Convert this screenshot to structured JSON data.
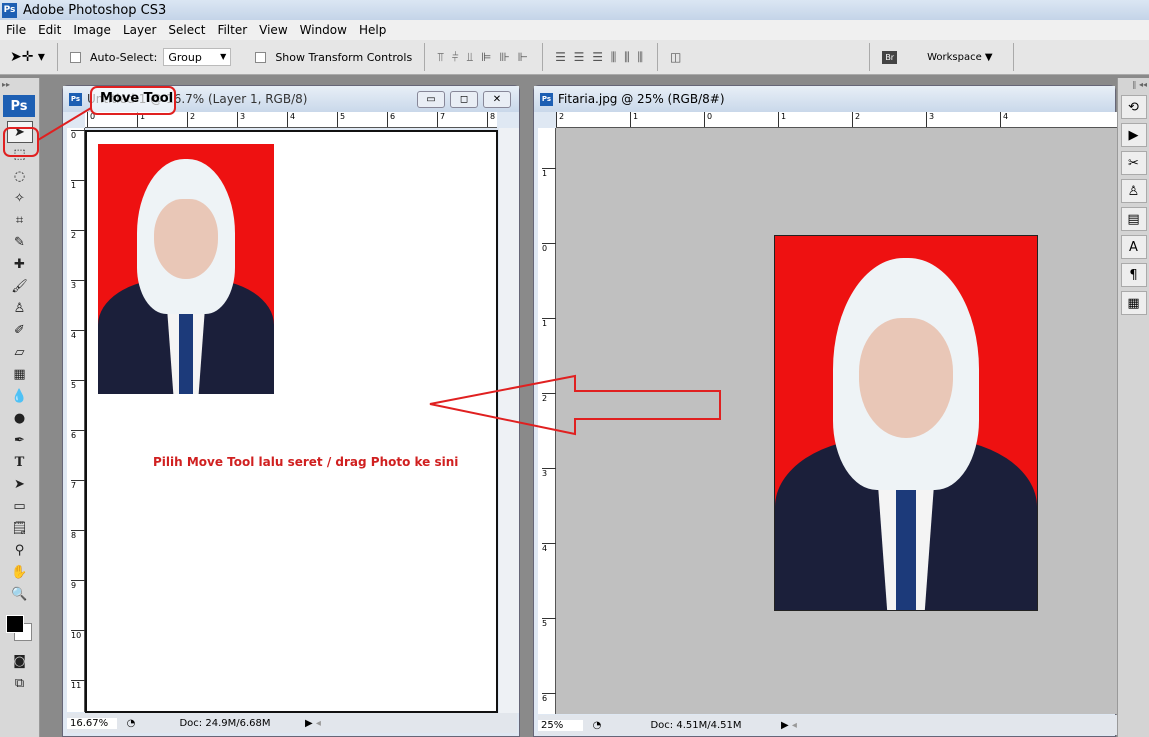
{
  "app": {
    "title": "Adobe Photoshop CS3",
    "logo": "Ps"
  },
  "menu": [
    "File",
    "Edit",
    "Image",
    "Layer",
    "Select",
    "Filter",
    "View",
    "Window",
    "Help"
  ],
  "options": {
    "auto_select_label": "Auto-Select:",
    "auto_select_value": "Group",
    "show_transform_label": "Show Transform Controls",
    "workspace_label": "Workspace ▼",
    "bridge_icon": "Br"
  },
  "doc1": {
    "title": "Untitled-1 @ 16.7% (Layer 1, RGB/8)",
    "zoom": "16.67%",
    "doc_info": "Doc: 24.9M/6.68M",
    "ruler_h": [
      "0",
      "1",
      "2",
      "3",
      "4",
      "5",
      "6",
      "7",
      "8"
    ],
    "ruler_v": [
      "0",
      "1",
      "2",
      "3",
      "4",
      "5",
      "6",
      "7",
      "8",
      "9",
      "10",
      "11"
    ]
  },
  "doc2": {
    "title": "Fitaria.jpg @ 25% (RGB/8#)",
    "zoom": "25%",
    "doc_info": "Doc: 4.51M/4.51M",
    "ruler_h": [
      "2",
      "1",
      "0",
      "1",
      "2",
      "3",
      "4"
    ],
    "ruler_v": [
      "1",
      "0",
      "1",
      "2",
      "3",
      "4",
      "5",
      "6"
    ]
  },
  "annotations": {
    "callout": "Move Tool",
    "instruction": "Pilih Move Tool lalu seret / drag Photo ke sini",
    "color": "#e02020"
  },
  "toolbox": {
    "icons": [
      "move",
      "marquee",
      "lasso",
      "magic-wand",
      "crop",
      "slice",
      "healing",
      "brush",
      "stamp",
      "history-brush",
      "eraser",
      "gradient",
      "blur",
      "dodge",
      "pen",
      "type",
      "path-select",
      "shape",
      "notes",
      "eyedropper",
      "hand",
      "zoom"
    ]
  }
}
